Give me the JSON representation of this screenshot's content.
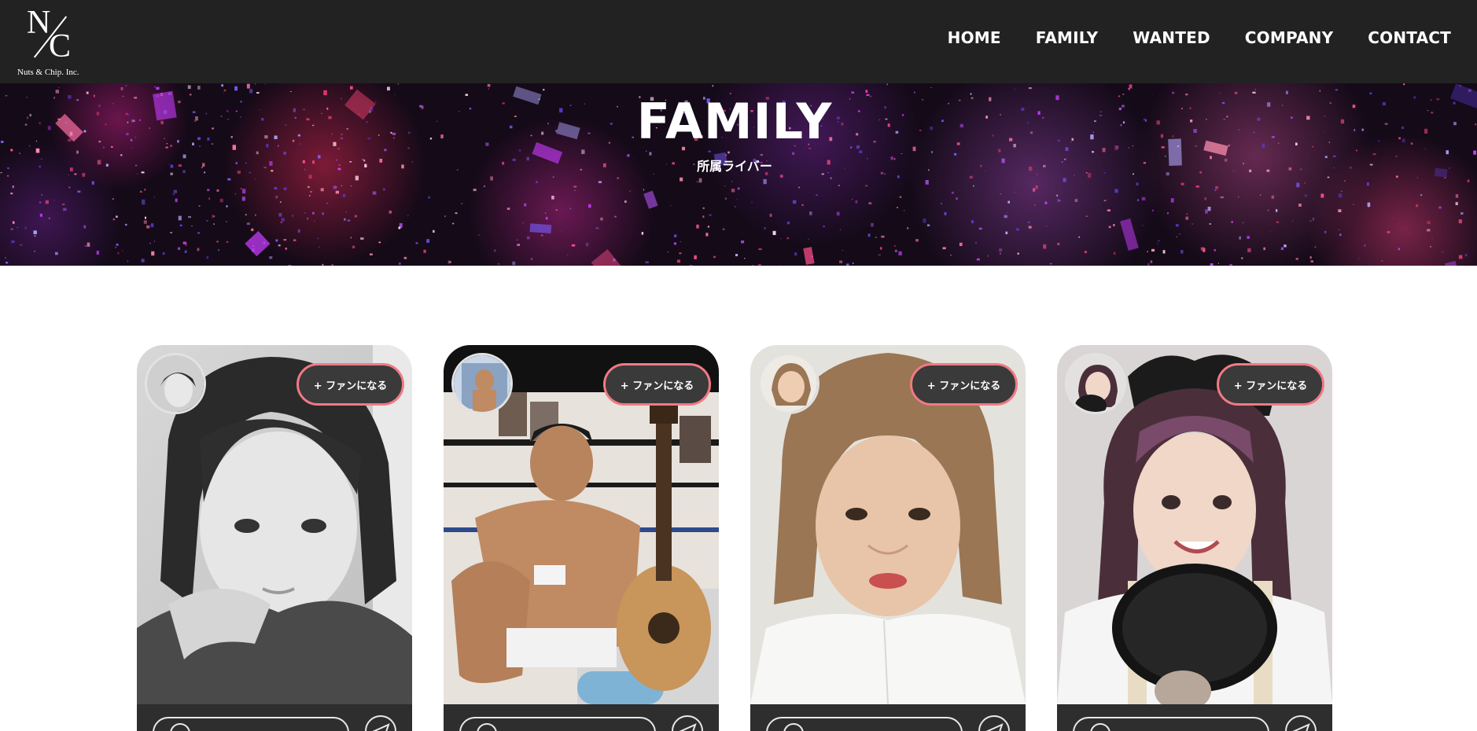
{
  "header": {
    "logo_text": "Nuts & Chip. Inc.",
    "logo_letters": {
      "n": "N",
      "c": "C"
    },
    "nav": [
      "HOME",
      "FAMILY",
      "WANTED",
      "COMPANY",
      "CONTACT"
    ]
  },
  "hero": {
    "title": "FAMILY",
    "subtitle": "所属ライバー"
  },
  "cards": [
    {
      "fan_label": "+ ファンになる",
      "theme": "monochrome"
    },
    {
      "fan_label": "+ ファンになる",
      "theme": "boxing-ring"
    },
    {
      "fan_label": "+ ファンになる",
      "theme": "portrait-warm"
    },
    {
      "fan_label": "+ ファンになる",
      "theme": "studio-mic"
    }
  ],
  "colors": {
    "header_bg": "#222222",
    "accent_border": "#f07a84",
    "fan_button_bg": "#3a3a3a",
    "card_footer_bg": "#2e2e2e"
  },
  "icons": [
    "logo-mark",
    "comment-icon",
    "send-icon"
  ]
}
